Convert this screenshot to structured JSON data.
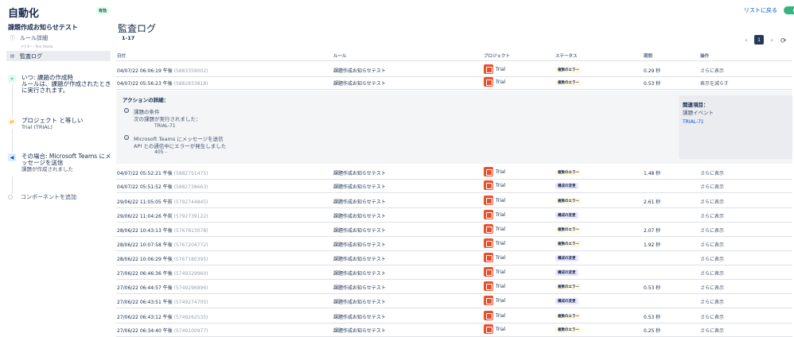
{
  "header": {
    "title": "自動化",
    "badge": "有効",
    "back_link": "リストに戻る"
  },
  "sidebar": {
    "rule_name": "課題作成お知らせテスト",
    "nav": [
      {
        "label": "ルール詳細",
        "icon": "info-icon"
      },
      {
        "label": "監査ログ",
        "icon": "log-icon"
      }
    ],
    "nav_sub": "アクター: Tom Okada",
    "trigger": {
      "title": "いつ: 課題の作成時",
      "desc": "ルールは、課題が作成されたときに実行されます。"
    },
    "condition": {
      "title": "プロジェクト と等しい",
      "desc": "Trial (TRIAL)"
    },
    "action": {
      "title": "その場合: Microsoft Teams にメッセージを送信",
      "desc": "課題が作成されました"
    },
    "add_component": "コンポーネントを追加"
  },
  "main": {
    "title": "監査ログ",
    "count": "1-17",
    "page": "1",
    "columns": [
      "日付",
      "ルール",
      "プロジェクト",
      "ステータス",
      "期間",
      "操作"
    ],
    "rows": [
      {
        "date": "04/07/22 06:06:19 午後",
        "id": "(5883359002)",
        "rule": "課題作成お知らせテスト",
        "project": "Trial",
        "status": "複数のエラー",
        "kind": "err",
        "duration": "0.29 秒",
        "op": "さらに表示"
      },
      {
        "date": "04/07/22 05:56:23 午後",
        "id": "(5882833818)",
        "rule": "課題作成お知らせテスト",
        "project": "Trial",
        "status": "複数のエラー",
        "kind": "err",
        "duration": "0.53 秒",
        "op": "表示を減らす"
      },
      {
        "date": "04/07/22 05:52:21 午後",
        "id": "(5882751475)",
        "rule": "課題作成お知らせテスト",
        "project": "Trial",
        "status": "複数のエラー",
        "kind": "err",
        "duration": "1.48 秒",
        "op": "さらに表示"
      },
      {
        "date": "04/07/22 05:51:52 午後",
        "id": "(5882738663)",
        "rule": "課題作成お知らせテスト",
        "project": "Trial",
        "status": "構成の変更",
        "kind": "chg",
        "duration": "",
        "op": "さらに表示"
      },
      {
        "date": "29/06/22 11:05:05 午前",
        "id": "(5792744845)",
        "rule": "課題作成お知らせテスト",
        "project": "Trial",
        "status": "複数のエラー",
        "kind": "err",
        "duration": "2.61 秒",
        "op": "さらに表示"
      },
      {
        "date": "29/06/22 11:04:26 午前",
        "id": "(5792739122)",
        "rule": "課題作成お知らせテスト",
        "project": "Trial",
        "status": "構成の変更",
        "kind": "chg",
        "duration": "",
        "op": "さらに表示"
      },
      {
        "date": "28/06/22 10:43:13 午後",
        "id": "(5767813078)",
        "rule": "課題作成お知らせテスト",
        "project": "Trial",
        "status": "複数のエラー",
        "kind": "err",
        "duration": "2.07 秒",
        "op": "さらに表示"
      },
      {
        "date": "28/06/22 10:07:58 午後",
        "id": "(5767204772)",
        "rule": "課題作成お知らせテスト",
        "project": "Trial",
        "status": "複数のエラー",
        "kind": "err",
        "duration": "1.92 秒",
        "op": "さらに表示"
      },
      {
        "date": "28/06/22 10:06:29 午後",
        "id": "(5767180395)",
        "rule": "課題作成お知らせテスト",
        "project": "Trial",
        "status": "構成の変更",
        "kind": "chg",
        "duration": "",
        "op": "さらに表示"
      },
      {
        "date": "27/06/22 06:46:36 午後",
        "id": "(5749329960)",
        "rule": "課題作成お知らせテスト",
        "project": "Trial",
        "status": "構成の変更",
        "kind": "chg",
        "duration": "",
        "op": "さらに表示"
      },
      {
        "date": "27/06/22 06:44:57 午後",
        "id": "(5749296896)",
        "rule": "課題作成お知らせテスト",
        "project": "Trial",
        "status": "複数のエラー",
        "kind": "err",
        "duration": "0.53 秒",
        "op": "さらに表示"
      },
      {
        "date": "27/06/22 06:43:51 午後",
        "id": "(5749274705)",
        "rule": "課題作成お知らせテスト",
        "project": "Trial",
        "status": "構成の変更",
        "kind": "chg",
        "duration": "",
        "op": "さらに表示"
      },
      {
        "date": "27/06/22 06:43:12 午後",
        "id": "(5749262535)",
        "rule": "課題作成お知らせテスト",
        "project": "Trial",
        "status": "複数のエラー",
        "kind": "err",
        "duration": "0.53 秒",
        "op": "さらに表示"
      },
      {
        "date": "27/06/22 06:34:40 午後",
        "id": "(5749100977)",
        "rule": "課題作成お知らせテスト",
        "project": "Trial",
        "status": "複数のエラー",
        "kind": "err",
        "duration": "0.25 秒",
        "op": "さらに表示"
      }
    ],
    "details": {
      "title": "アクションの詳細：",
      "items": [
        {
          "head": "課題の条件",
          "line1": "次の課題が実行されました：",
          "line2": "TRIAL-71"
        },
        {
          "head": "Microsoft Teams にメッセージを送信",
          "line1": "API との通信中にエラーが発生しました",
          "line2": "405 -"
        }
      ],
      "related_title": "関連項目：",
      "related_sub": "課題イベント",
      "related_link": "TRIAL-71"
    }
  }
}
